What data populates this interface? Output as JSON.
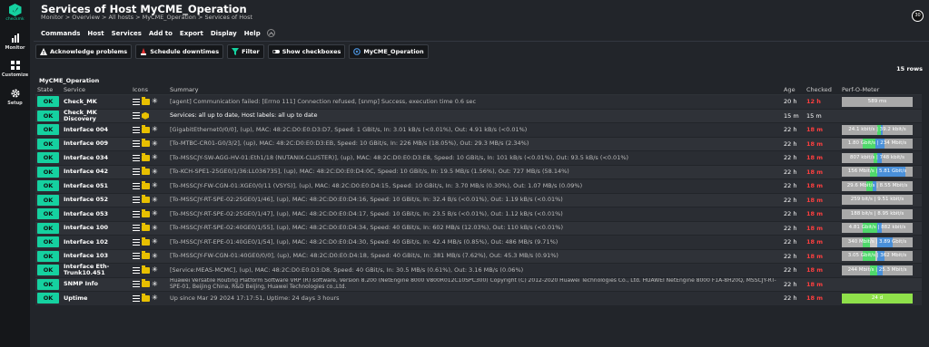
{
  "app": {
    "logo_text": "checkmk"
  },
  "sidebar": {
    "items": [
      {
        "label": "Monitor"
      },
      {
        "label": "Customize"
      },
      {
        "label": "Setup"
      }
    ]
  },
  "header": {
    "title": "Services of Host MyCME_Operation",
    "breadcrumb": "Monitor > Overview > All hosts > MyCME_Operation > Services of Host",
    "refresh_counter": "30"
  },
  "menu": {
    "items": [
      "Commands",
      "Host",
      "Services",
      "Add to",
      "Export",
      "Display",
      "Help"
    ]
  },
  "toolbar": {
    "buttons": [
      {
        "label": "Acknowledge problems"
      },
      {
        "label": "Schedule downtimes"
      },
      {
        "label": "Filter"
      },
      {
        "label": "Show checkboxes"
      },
      {
        "label": "MyCME_Operation"
      }
    ]
  },
  "table": {
    "rows_count": "15 rows",
    "group": "MyCME_Operation",
    "columns": {
      "state": "State",
      "service": "Service",
      "icons": "Icons",
      "summary": "Summary",
      "age": "Age",
      "checked": "Checked",
      "perf": "Perf-O-Meter"
    },
    "rows": [
      {
        "state": "OK",
        "service": "Check_MK",
        "summary": "[agent] Communication failed: [Errno 111] Connection refused, [snmp] Success, execution time 0.6 sec",
        "age": "20 h",
        "checked": "12 h",
        "perf": "589 ms"
      },
      {
        "state": "OK",
        "service": "Check_MK Discovery",
        "summary": "Services: all up to date, Host labels: all up to date",
        "age": "15 m",
        "checked": "15 m",
        "perf": ""
      },
      {
        "state": "OK",
        "service": "Interface 004",
        "summary": "[GigabitEthernet0/0/0], (up), MAC: 48:2C:D0:E0:D3:D7, Speed: 1 GBit/s, In: 3.01 kB/s (<0.01%), Out: 4.91 kB/s (<0.01%)",
        "age": "22 h",
        "checked": "18 m",
        "perf": "24.1 kbit/s | 39.2 kbit/s"
      },
      {
        "state": "OK",
        "service": "Interface 009",
        "summary": "[To-MTBC-CR01-G0/3/2], (up), MAC: 48:2C:D0:E0:D3:EB, Speed: 10 GBit/s, In: 226 MB/s (18.05%), Out: 29.3 MB/s (2.34%)",
        "age": "22 h",
        "checked": "18 m",
        "perf": "1.80 Gbit/s | 234 Mbit/s"
      },
      {
        "state": "OK",
        "service": "Interface 034",
        "summary": "[To-MSSCJY-SW-AGG-HV-01:Eth1/18 (NUTANIX-CLUSTER)], (up), MAC: 48:2C:D0:E0:D3:E8, Speed: 10 GBit/s, In: 101 kB/s (<0.01%), Out: 93.5 kB/s (<0.01%)",
        "age": "22 h",
        "checked": "18 m",
        "perf": "807 kbit/s | 748 kbit/s"
      },
      {
        "state": "OK",
        "service": "Interface 042",
        "summary": "[To-KCH-SPE1-25GE0/1/36:LL036735], (up), MAC: 48:2C:D0:E0:D4:0C, Speed: 10 GBit/s, In: 19.5 MB/s (1.56%), Out: 727 MB/s (58.14%)",
        "age": "22 h",
        "checked": "18 m",
        "perf": "156 Mbit/s | 5.81 Gbit/s"
      },
      {
        "state": "OK",
        "service": "Interface 051",
        "summary": "[To-MSSCJY-FW-CGN-01:XGE0/0/11 (VSYS)], (up), MAC: 48:2C:D0:E0:D4:15, Speed: 10 GBit/s, In: 3.70 MB/s (0.30%), Out: 1.07 MB/s (0.09%)",
        "age": "22 h",
        "checked": "18 m",
        "perf": "29.6 Mbit/s | 8.55 Mbit/s"
      },
      {
        "state": "OK",
        "service": "Interface 052",
        "summary": "[To-MSSCJY-RT-SPE-02:25GE0/1/46], (up), MAC: 48:2C:D0:E0:D4:16, Speed: 10 GBit/s, In: 32.4 B/s (<0.01%), Out: 1.19 kB/s (<0.01%)",
        "age": "22 h",
        "checked": "18 m",
        "perf": "259 bit/s | 9.51 kbit/s"
      },
      {
        "state": "OK",
        "service": "Interface 053",
        "summary": "[To-MSSCJY-RT-SPE-02:25GE0/1/47], (up), MAC: 48:2C:D0:E0:D4:17, Speed: 10 GBit/s, In: 23.5 B/s (<0.01%), Out: 1.12 kB/s (<0.01%)",
        "age": "22 h",
        "checked": "18 m",
        "perf": "188 bit/s | 8.95 kbit/s"
      },
      {
        "state": "OK",
        "service": "Interface 100",
        "summary": "[To-MSSCJY-RT-SPE-02:40GE0/1/55], (up), MAC: 48:2C:D0:E0:D4:34, Speed: 40 GBit/s, In: 602 MB/s (12.03%), Out: 110 kB/s (<0.01%)",
        "age": "22 h",
        "checked": "18 m",
        "perf": "4.81 Gbit/s | 882 kbit/s"
      },
      {
        "state": "OK",
        "service": "Interface 102",
        "summary": "[To-MSSCJY-RT-EPE-01:40GE0/1/54], (up), MAC: 48:2C:D0:E0:D4:30, Speed: 40 GBit/s, In: 42.4 MB/s (0.85%), Out: 486 MB/s (9.71%)",
        "age": "22 h",
        "checked": "18 m",
        "perf": "340 Mbit/s | 3.89 Gbit/s"
      },
      {
        "state": "OK",
        "service": "Interface 103",
        "summary": "[To-MSSCJY-FW-CGN-01:40GE0/0/0], (up), MAC: 48:2C:D0:E0:D4:18, Speed: 40 GBit/s, In: 381 MB/s (7.62%), Out: 45.3 MB/s (0.91%)",
        "age": "22 h",
        "checked": "18 m",
        "perf": "3.05 Gbit/s | 362 Mbit/s"
      },
      {
        "state": "OK",
        "service": "Interface Eth-Trunk10.451",
        "summary": "[Service:MEAS-MCMC], (up), MAC: 48:2C:D0:E0:D3:D8, Speed: 40 GBit/s, In: 30.5 MB/s (0.61%), Out: 3.16 MB/s (0.06%)",
        "age": "22 h",
        "checked": "18 m",
        "perf": "244 Mbit/s | 25.3 Mbit/s"
      },
      {
        "state": "OK",
        "service": "SNMP Info",
        "summary": "Huawei Versatile Routing Platform Software VRP (R) software, Version 8.200 (NetEngine 8000 V800R012C10SPC300) Copyright (C) 2012-2020 Huawei Technologies Co., Ltd. HUAWEI NetEngine 8000 F1A-8H20Q, MSSCJY-RT-SPE-01, Beijing China, R&D Beijing, Huawei Technologies co.,Ltd.",
        "age": "22 h",
        "checked": "18 m",
        "perf": ""
      },
      {
        "state": "OK",
        "service": "Uptime",
        "summary": "Up since Mar 29 2024 17:17:51, Uptime: 24 days 3 hours",
        "age": "22 h",
        "checked": "18 m",
        "perf": "24 d"
      }
    ]
  },
  "colors": {
    "ok": "#15d1a0",
    "stale": "#ff3f3f",
    "accent": "#15d1a0",
    "in": "#4fd86b",
    "out": "#4a90d9"
  }
}
